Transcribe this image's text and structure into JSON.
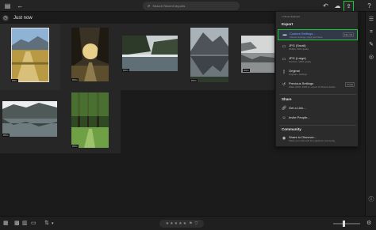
{
  "search": {
    "placeholder": "Search Recent Imports"
  },
  "section": {
    "title": "Just now"
  },
  "photos": [
    {
      "name": "road-field",
      "badge": "DNG"
    },
    {
      "name": "forest-sunset",
      "badge": "DNG"
    },
    {
      "name": "misty-lake",
      "badge": "DNG"
    },
    {
      "name": "mountain-lake",
      "badge": "DNG"
    },
    {
      "name": "fog-reflection",
      "badge": "DNG"
    },
    {
      "name": "snowy-lake",
      "badge": "DNG"
    },
    {
      "name": "green-forest",
      "badge": "DNG"
    }
  ],
  "export_menu": {
    "info": "1 Photo Selected",
    "heading": "Export",
    "items": [
      {
        "title": "Custom Settings...",
        "sub": "Choose Settings, Apply and Save",
        "key": "Ctrl+⇧E",
        "icon": "custom-settings-icon"
      },
      {
        "title": "JPG (Small)",
        "sub": "2048px, 80% quality",
        "key": "",
        "icon": "jpg-small-icon"
      },
      {
        "title": "JPG (Large)",
        "sub": "Full Size, 100% quality",
        "key": "",
        "icon": "jpg-large-icon"
      },
      {
        "title": "Original",
        "sub": "Original + Settings",
        "key": "",
        "icon": "original-icon"
      },
      {
        "title": "Previous Settings",
        "sub": "JPEG 100%, 2048 px, export to Pictures Folder",
        "key": "Ctrl+E",
        "icon": "previous-settings-icon"
      }
    ],
    "share_heading": "Share",
    "share_items": [
      {
        "title": "Get a Link...",
        "icon": "link-icon"
      },
      {
        "title": "Invite People...",
        "icon": "invite-icon"
      }
    ],
    "community_heading": "Community",
    "community_items": [
      {
        "title": "Share to Discover...",
        "sub": "Share your edits with the Lightroom community",
        "icon": "discover-icon"
      }
    ]
  },
  "rating": {
    "stars": [
      "★",
      "★",
      "★",
      "★",
      "★"
    ],
    "flag": "⚑",
    "filter": "⛉"
  },
  "colors": {
    "accent_selection": "#1fc93c",
    "link": "#6ea3ff"
  }
}
